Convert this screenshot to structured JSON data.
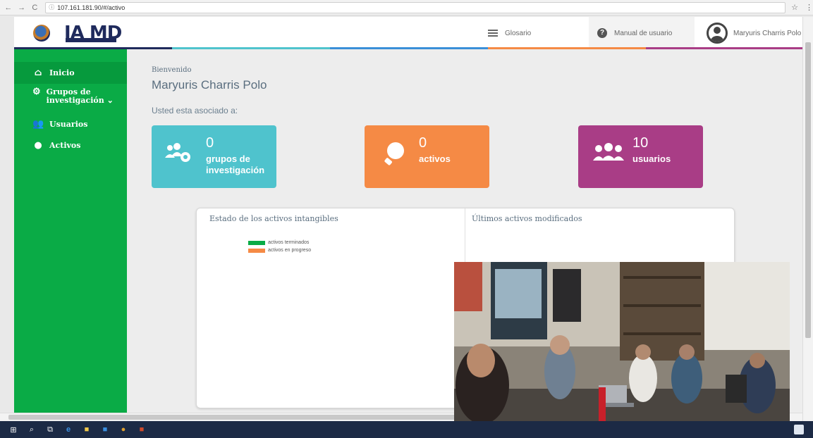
{
  "browser": {
    "url": "107.161.181.90/#/activo"
  },
  "header": {
    "logo_text": "IA MD",
    "glosario": "Glosario",
    "manual": "Manual de usuario",
    "user_name": "Maryuris Charris Polo"
  },
  "accent_colors": [
    "#1f2a5c",
    "#4fc3cd",
    "#f58a45",
    "#a93d86",
    "#0aab46"
  ],
  "sidebar": {
    "items": [
      {
        "label": "Inicio",
        "icon": "home-icon"
      },
      {
        "label": "Grupos de investigación",
        "icon": "groups-gear-icon"
      },
      {
        "label": "Usuarios",
        "icon": "users-icon"
      },
      {
        "label": "Activos",
        "icon": "lightbulb-icon"
      }
    ]
  },
  "main": {
    "welcome": "Bienvenido",
    "user_name": "Maryuris Charris Polo",
    "associated": "Usted esta asociado a:",
    "cards": [
      {
        "count": "0",
        "label": "grupos de investigación",
        "color": "#4fc3cd"
      },
      {
        "count": "0",
        "label": "activos",
        "color": "#f58a45"
      },
      {
        "count": "10",
        "label": "usuarios",
        "color": "#a93d86"
      }
    ]
  },
  "panel": {
    "left_title": "Estado de los activos intangibles",
    "right_title": "Últimos activos modificados",
    "legend": [
      {
        "label": "activos terminados",
        "color": "#0aab46"
      },
      {
        "label": "activos en progreso",
        "color": "#f58a45"
      }
    ]
  }
}
